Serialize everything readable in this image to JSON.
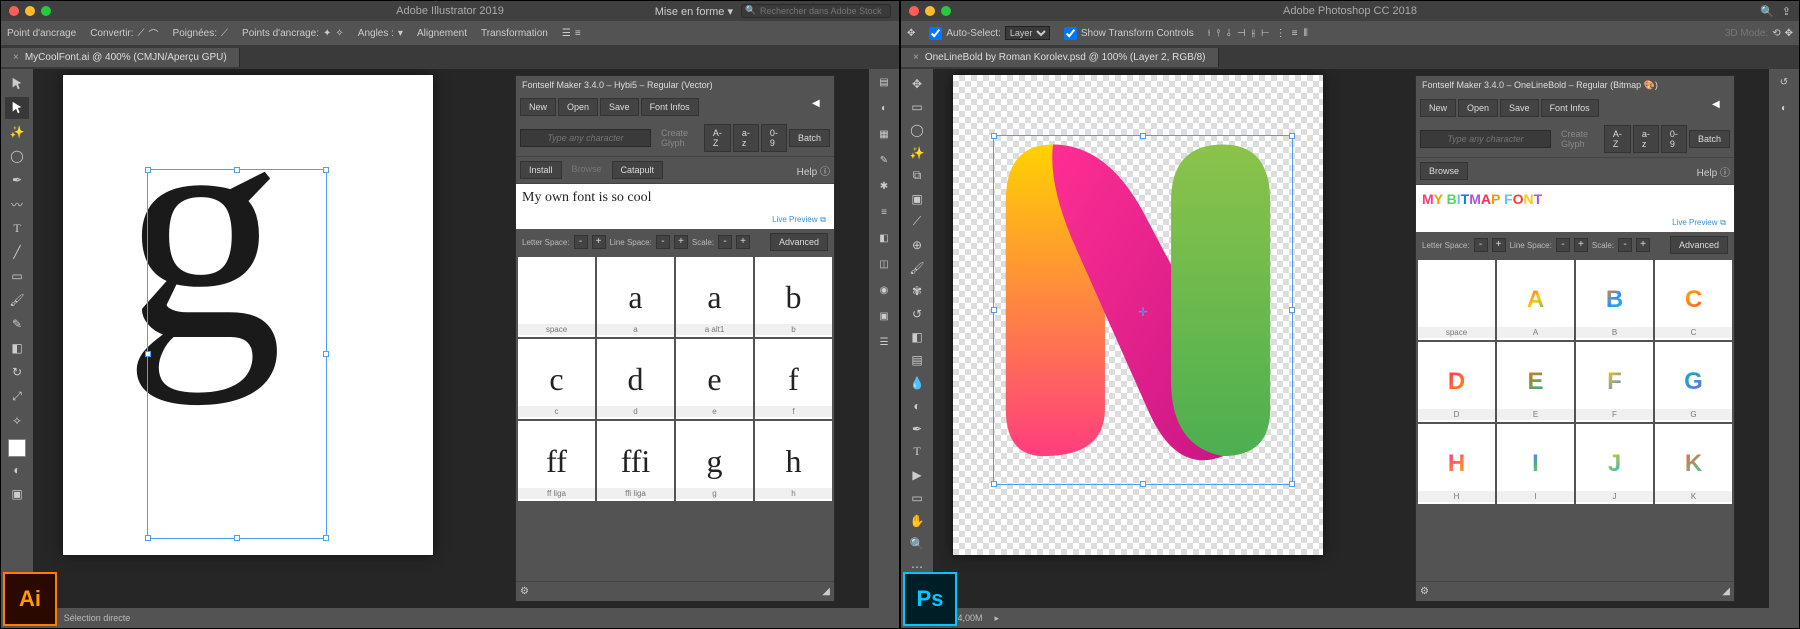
{
  "illustrator": {
    "title": "Adobe Illustrator 2019",
    "format_label": "Mise en forme ▾",
    "search_placeholder": "Rechercher dans Adobe Stock",
    "options_bar": {
      "anchor": "Point d'ancrage",
      "convert": "Convertir:",
      "handles": "Poignées:",
      "anchors": "Points d'ancrage:",
      "angles": "Angles :",
      "alignment": "Alignement",
      "transformation": "Transformation"
    },
    "tab": "MyCoolFont.ai @ 400% (CMJN/Aperçu GPU)",
    "statusbar": {
      "tool": "Sélection directe"
    },
    "canvas_letter": "g"
  },
  "photoshop": {
    "title": "Adobe Photoshop CC 2018",
    "options_bar": {
      "auto_select": "Auto-Select:",
      "layer": "Layer",
      "show_transform": "Show Transform Controls",
      "mode": "3D Mode:"
    },
    "tab": "OneLineBold by Roman Korolev.psd @ 100% (Layer 2, RGB/8)",
    "statusbar": {
      "doc": "Doc: 71,9M/4,00M"
    }
  },
  "fontself_ai": {
    "title": "Fontself Maker 3.4.0 – Hybi5 – Regular (Vector)",
    "buttons": {
      "new": "New",
      "open": "Open",
      "save": "Save",
      "infos": "Font Infos"
    },
    "type_placeholder": "Type any character",
    "create_glyph": "Create Glyph",
    "ranges": {
      "AZ": "A-Z",
      "az": "a-z",
      "n09": "0-9",
      "batch": "Batch"
    },
    "tabs": {
      "install": "Install",
      "browse": "Browse",
      "catapult": "Catapult"
    },
    "help": "Help",
    "preview_text": "My own font is so cool",
    "live_preview": "Live Preview",
    "spacing": {
      "letter": "Letter Space:",
      "line": "Line Space:",
      "scale": "Scale:",
      "advanced": "Advanced"
    },
    "glyphs": [
      [
        {
          "g": "",
          "l": "space"
        },
        {
          "g": "a",
          "l": "a"
        },
        {
          "g": "a",
          "l": "a   alt1"
        },
        {
          "g": "b",
          "l": "b"
        }
      ],
      [
        {
          "g": "c",
          "l": "c"
        },
        {
          "g": "d",
          "l": "d"
        },
        {
          "g": "e",
          "l": "e"
        },
        {
          "g": "f",
          "l": "f"
        }
      ],
      [
        {
          "g": "ff",
          "l": "ff   liga"
        },
        {
          "g": "ffi",
          "l": "ffi   liga"
        },
        {
          "g": "g",
          "l": "g"
        },
        {
          "g": "h",
          "l": "h"
        }
      ]
    ]
  },
  "fontself_ps": {
    "title": "Fontself Maker 3.4.0 – OneLineBold – Regular (Bitmap 🎨)",
    "buttons": {
      "new": "New",
      "open": "Open",
      "save": "Save",
      "infos": "Font Infos"
    },
    "type_placeholder": "Type any character",
    "create_glyph": "Create Glyph",
    "ranges": {
      "AZ": "A-Z",
      "az": "a-z",
      "n09": "0-9",
      "batch": "Batch"
    },
    "tabs": {
      "browse": "Browse"
    },
    "help": "Help",
    "preview_text": "MY BITMAP FONT",
    "live_preview": "Live Preview",
    "spacing": {
      "letter": "Letter Space:",
      "line": "Line Space:",
      "scale": "Scale:",
      "advanced": "Advanced"
    },
    "glyphs": [
      [
        {
          "g": "",
          "l": "space"
        },
        {
          "g": "A",
          "l": "A",
          "c": [
            "#ff3b7a",
            "#ffc800",
            "#2ecc71"
          ]
        },
        {
          "g": "B",
          "l": "B",
          "c": [
            "#ff8a00",
            "#2b90ff",
            "#22c98f"
          ]
        },
        {
          "g": "C",
          "l": "C",
          "c": [
            "#ffb300",
            "#ff4e3a"
          ]
        }
      ],
      [
        {
          "g": "D",
          "l": "D",
          "c": [
            "#ff2e63",
            "#ff9a00"
          ]
        },
        {
          "g": "E",
          "l": "E",
          "c": [
            "#ff6a00",
            "#00c2a8"
          ]
        },
        {
          "g": "F",
          "l": "F",
          "c": [
            "#ffcc00",
            "#3a7bff"
          ]
        },
        {
          "g": "G",
          "l": "G",
          "c": [
            "#00c2a8",
            "#7a5cff"
          ]
        }
      ],
      [
        {
          "g": "H",
          "l": "H",
          "c": [
            "#ff2e92",
            "#ffb300"
          ]
        },
        {
          "g": "I",
          "l": "I",
          "c": [
            "#3a7bff",
            "#77dd22"
          ]
        },
        {
          "g": "J",
          "l": "J",
          "c": [
            "#ffcc00",
            "#00b7eb"
          ]
        },
        {
          "g": "K",
          "l": "K",
          "c": [
            "#ff5e3a",
            "#3ad6a0"
          ]
        }
      ]
    ]
  }
}
